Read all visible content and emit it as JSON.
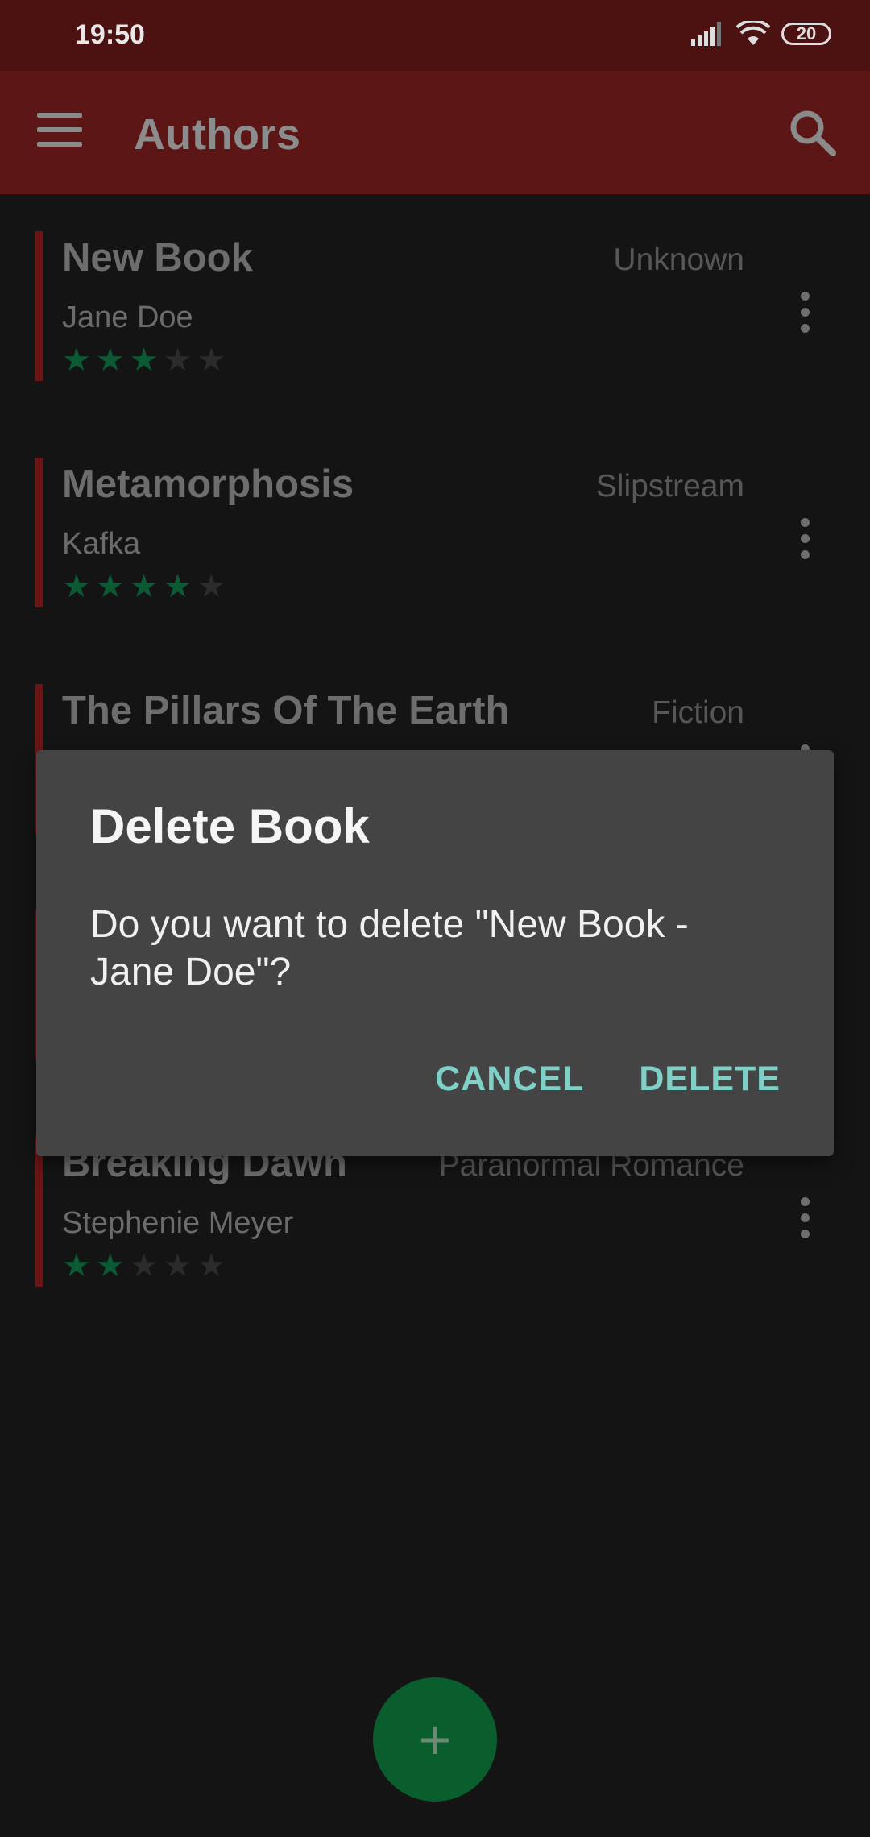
{
  "status_bar": {
    "time": "19:50",
    "battery": "20"
  },
  "app_bar": {
    "title": "Authors"
  },
  "books": [
    {
      "title": "New Book",
      "author": "Jane Doe",
      "genre": "Unknown",
      "rating": 3
    },
    {
      "title": "Metamorphosis",
      "author": "Kafka",
      "genre": "Slipstream",
      "rating": 4
    },
    {
      "title": "The Pillars Of The Earth",
      "author": "",
      "genre": "Fiction",
      "rating": 0
    },
    {
      "title": "Breaking Dawn",
      "author": "Stephenie Meyer",
      "genre": "Paranormal Romance",
      "rating": 2
    }
  ],
  "dialog": {
    "title": "Delete Book",
    "message": "Do you want to delete \"New Book - Jane Doe\"?",
    "cancel_label": "CANCEL",
    "delete_label": "DELETE"
  },
  "fab": {
    "icon": "plus-icon",
    "label": "+"
  },
  "colors": {
    "app_bar": "#5d1616",
    "status_bar": "#4c1111",
    "accent": "#7fd0c6",
    "fab": "#0a5e2d",
    "star": "#0b5a34"
  }
}
